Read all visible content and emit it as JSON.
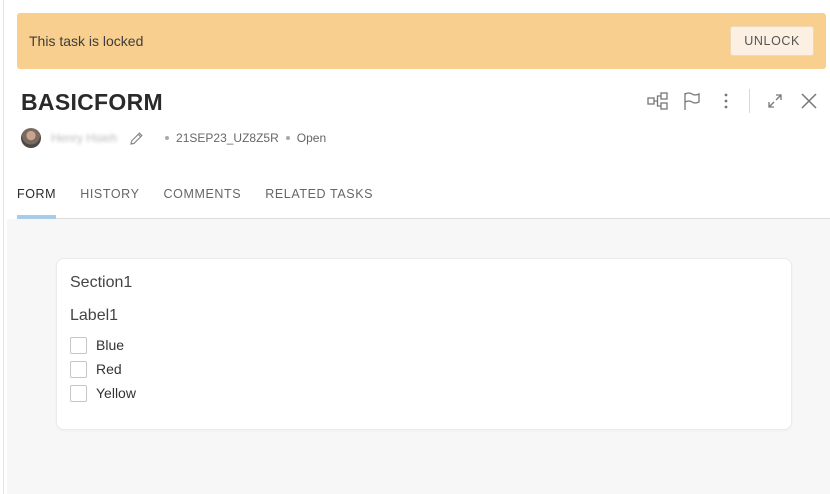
{
  "banner": {
    "message": "This task is locked",
    "unlock_label": "UNLOCK"
  },
  "task": {
    "title": "BASICFORM",
    "assignee": "Henry Hsieh",
    "task_id": "21SEP23_UZ8Z5R",
    "status": "Open"
  },
  "header_icons": [
    "workflow-icon",
    "flag-icon",
    "more-options-icon",
    "expand-icon",
    "close-icon"
  ],
  "tabs": [
    {
      "label": "FORM",
      "active": true
    },
    {
      "label": "HISTORY",
      "active": false
    },
    {
      "label": "COMMENTS",
      "active": false
    },
    {
      "label": "RELATED TASKS",
      "active": false
    }
  ],
  "form": {
    "section_title": "Section1",
    "field_label": "Label1",
    "options": [
      {
        "label": "Blue",
        "checked": false
      },
      {
        "label": "Red",
        "checked": false
      },
      {
        "label": "Yellow",
        "checked": false
      }
    ]
  },
  "colors": {
    "banner_bg": "#f8cf8e",
    "tab_indicator": "#a8cce8",
    "content_bg": "#f7f7f7"
  }
}
